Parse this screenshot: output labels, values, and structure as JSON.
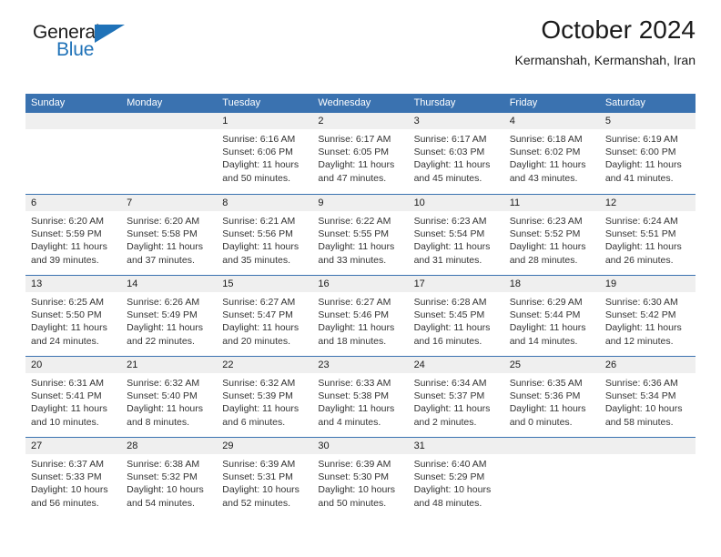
{
  "logo": {
    "word1": "General",
    "word2": "Blue",
    "triangle_color": "#1f72b8"
  },
  "header": {
    "title": "October 2024",
    "subtitle": "Kermanshah, Kermanshah, Iran"
  },
  "theme": {
    "header_blue": "#3a72b0",
    "daynum_band": "#efefef",
    "text": "#1a1a1a"
  },
  "calendar": {
    "weekday_headers": [
      "Sunday",
      "Monday",
      "Tuesday",
      "Wednesday",
      "Thursday",
      "Friday",
      "Saturday"
    ],
    "weeks": [
      [
        {
          "day": "",
          "sunrise": "",
          "sunset": "",
          "daylight_line1": "",
          "daylight_line2": ""
        },
        {
          "day": "",
          "sunrise": "",
          "sunset": "",
          "daylight_line1": "",
          "daylight_line2": ""
        },
        {
          "day": "1",
          "sunrise": "Sunrise: 6:16 AM",
          "sunset": "Sunset: 6:06 PM",
          "daylight_line1": "Daylight: 11 hours",
          "daylight_line2": "and 50 minutes."
        },
        {
          "day": "2",
          "sunrise": "Sunrise: 6:17 AM",
          "sunset": "Sunset: 6:05 PM",
          "daylight_line1": "Daylight: 11 hours",
          "daylight_line2": "and 47 minutes."
        },
        {
          "day": "3",
          "sunrise": "Sunrise: 6:17 AM",
          "sunset": "Sunset: 6:03 PM",
          "daylight_line1": "Daylight: 11 hours",
          "daylight_line2": "and 45 minutes."
        },
        {
          "day": "4",
          "sunrise": "Sunrise: 6:18 AM",
          "sunset": "Sunset: 6:02 PM",
          "daylight_line1": "Daylight: 11 hours",
          "daylight_line2": "and 43 minutes."
        },
        {
          "day": "5",
          "sunrise": "Sunrise: 6:19 AM",
          "sunset": "Sunset: 6:00 PM",
          "daylight_line1": "Daylight: 11 hours",
          "daylight_line2": "and 41 minutes."
        }
      ],
      [
        {
          "day": "6",
          "sunrise": "Sunrise: 6:20 AM",
          "sunset": "Sunset: 5:59 PM",
          "daylight_line1": "Daylight: 11 hours",
          "daylight_line2": "and 39 minutes."
        },
        {
          "day": "7",
          "sunrise": "Sunrise: 6:20 AM",
          "sunset": "Sunset: 5:58 PM",
          "daylight_line1": "Daylight: 11 hours",
          "daylight_line2": "and 37 minutes."
        },
        {
          "day": "8",
          "sunrise": "Sunrise: 6:21 AM",
          "sunset": "Sunset: 5:56 PM",
          "daylight_line1": "Daylight: 11 hours",
          "daylight_line2": "and 35 minutes."
        },
        {
          "day": "9",
          "sunrise": "Sunrise: 6:22 AM",
          "sunset": "Sunset: 5:55 PM",
          "daylight_line1": "Daylight: 11 hours",
          "daylight_line2": "and 33 minutes."
        },
        {
          "day": "10",
          "sunrise": "Sunrise: 6:23 AM",
          "sunset": "Sunset: 5:54 PM",
          "daylight_line1": "Daylight: 11 hours",
          "daylight_line2": "and 31 minutes."
        },
        {
          "day": "11",
          "sunrise": "Sunrise: 6:23 AM",
          "sunset": "Sunset: 5:52 PM",
          "daylight_line1": "Daylight: 11 hours",
          "daylight_line2": "and 28 minutes."
        },
        {
          "day": "12",
          "sunrise": "Sunrise: 6:24 AM",
          "sunset": "Sunset: 5:51 PM",
          "daylight_line1": "Daylight: 11 hours",
          "daylight_line2": "and 26 minutes."
        }
      ],
      [
        {
          "day": "13",
          "sunrise": "Sunrise: 6:25 AM",
          "sunset": "Sunset: 5:50 PM",
          "daylight_line1": "Daylight: 11 hours",
          "daylight_line2": "and 24 minutes."
        },
        {
          "day": "14",
          "sunrise": "Sunrise: 6:26 AM",
          "sunset": "Sunset: 5:49 PM",
          "daylight_line1": "Daylight: 11 hours",
          "daylight_line2": "and 22 minutes."
        },
        {
          "day": "15",
          "sunrise": "Sunrise: 6:27 AM",
          "sunset": "Sunset: 5:47 PM",
          "daylight_line1": "Daylight: 11 hours",
          "daylight_line2": "and 20 minutes."
        },
        {
          "day": "16",
          "sunrise": "Sunrise: 6:27 AM",
          "sunset": "Sunset: 5:46 PM",
          "daylight_line1": "Daylight: 11 hours",
          "daylight_line2": "and 18 minutes."
        },
        {
          "day": "17",
          "sunrise": "Sunrise: 6:28 AM",
          "sunset": "Sunset: 5:45 PM",
          "daylight_line1": "Daylight: 11 hours",
          "daylight_line2": "and 16 minutes."
        },
        {
          "day": "18",
          "sunrise": "Sunrise: 6:29 AM",
          "sunset": "Sunset: 5:44 PM",
          "daylight_line1": "Daylight: 11 hours",
          "daylight_line2": "and 14 minutes."
        },
        {
          "day": "19",
          "sunrise": "Sunrise: 6:30 AM",
          "sunset": "Sunset: 5:42 PM",
          "daylight_line1": "Daylight: 11 hours",
          "daylight_line2": "and 12 minutes."
        }
      ],
      [
        {
          "day": "20",
          "sunrise": "Sunrise: 6:31 AM",
          "sunset": "Sunset: 5:41 PM",
          "daylight_line1": "Daylight: 11 hours",
          "daylight_line2": "and 10 minutes."
        },
        {
          "day": "21",
          "sunrise": "Sunrise: 6:32 AM",
          "sunset": "Sunset: 5:40 PM",
          "daylight_line1": "Daylight: 11 hours",
          "daylight_line2": "and 8 minutes."
        },
        {
          "day": "22",
          "sunrise": "Sunrise: 6:32 AM",
          "sunset": "Sunset: 5:39 PM",
          "daylight_line1": "Daylight: 11 hours",
          "daylight_line2": "and 6 minutes."
        },
        {
          "day": "23",
          "sunrise": "Sunrise: 6:33 AM",
          "sunset": "Sunset: 5:38 PM",
          "daylight_line1": "Daylight: 11 hours",
          "daylight_line2": "and 4 minutes."
        },
        {
          "day": "24",
          "sunrise": "Sunrise: 6:34 AM",
          "sunset": "Sunset: 5:37 PM",
          "daylight_line1": "Daylight: 11 hours",
          "daylight_line2": "and 2 minutes."
        },
        {
          "day": "25",
          "sunrise": "Sunrise: 6:35 AM",
          "sunset": "Sunset: 5:36 PM",
          "daylight_line1": "Daylight: 11 hours",
          "daylight_line2": "and 0 minutes."
        },
        {
          "day": "26",
          "sunrise": "Sunrise: 6:36 AM",
          "sunset": "Sunset: 5:34 PM",
          "daylight_line1": "Daylight: 10 hours",
          "daylight_line2": "and 58 minutes."
        }
      ],
      [
        {
          "day": "27",
          "sunrise": "Sunrise: 6:37 AM",
          "sunset": "Sunset: 5:33 PM",
          "daylight_line1": "Daylight: 10 hours",
          "daylight_line2": "and 56 minutes."
        },
        {
          "day": "28",
          "sunrise": "Sunrise: 6:38 AM",
          "sunset": "Sunset: 5:32 PM",
          "daylight_line1": "Daylight: 10 hours",
          "daylight_line2": "and 54 minutes."
        },
        {
          "day": "29",
          "sunrise": "Sunrise: 6:39 AM",
          "sunset": "Sunset: 5:31 PM",
          "daylight_line1": "Daylight: 10 hours",
          "daylight_line2": "and 52 minutes."
        },
        {
          "day": "30",
          "sunrise": "Sunrise: 6:39 AM",
          "sunset": "Sunset: 5:30 PM",
          "daylight_line1": "Daylight: 10 hours",
          "daylight_line2": "and 50 minutes."
        },
        {
          "day": "31",
          "sunrise": "Sunrise: 6:40 AM",
          "sunset": "Sunset: 5:29 PM",
          "daylight_line1": "Daylight: 10 hours",
          "daylight_line2": "and 48 minutes."
        },
        {
          "day": "",
          "sunrise": "",
          "sunset": "",
          "daylight_line1": "",
          "daylight_line2": ""
        },
        {
          "day": "",
          "sunrise": "",
          "sunset": "",
          "daylight_line1": "",
          "daylight_line2": ""
        }
      ]
    ]
  }
}
